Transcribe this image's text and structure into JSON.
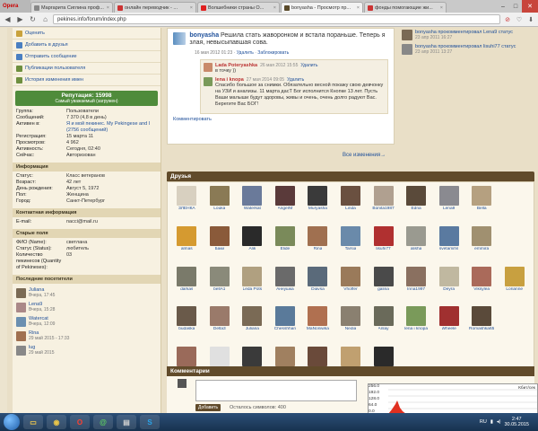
{
  "browser": {
    "menu_label": "Opera",
    "tabs": [
      {
        "label": "Маргарита Сиглина проф...",
        "fav_color": "#888"
      },
      {
        "label": "онлайн переводчик - ...",
        "fav_color": "#c33"
      },
      {
        "label": "Волшебники страны О...",
        "fav_color": "#e02020"
      },
      {
        "label": "bonyasha - Просмотр пр...",
        "fav_color": "#5a4a2a",
        "active": true
      },
      {
        "label": "фонды помогающие жи...",
        "fav_color": "#c33"
      }
    ],
    "url": "pekines.info/forum/index.php"
  },
  "sidebar": {
    "menu": [
      {
        "label": "Оценить",
        "color": "#c9a23c"
      },
      {
        "label": "Добавить в друзья",
        "color": "#4a7fc1"
      },
      {
        "label": "Отправить сообщение",
        "color": "#4a7fc1"
      },
      {
        "label": "Публикации пользователя",
        "color": "#6e8f3f"
      },
      {
        "label": "История изменения имен",
        "color": "#6e8f3f"
      }
    ],
    "reputation_title": "Репутация: 15998",
    "reputation_sub": "Самый уважаемый (загружен)",
    "profile": [
      {
        "k": "Группа:",
        "v": "Пользователи"
      },
      {
        "k": "Сообщений:",
        "v": "7 370 (4,8 в день)"
      },
      {
        "k": "Активен в:",
        "v": "Я и мой пекинес. My Pekingese and I (2756 сообщений)",
        "link": true
      },
      {
        "k": "Регистрация:",
        "v": "15 марта 11"
      },
      {
        "k": "Просмотров:",
        "v": "4 962"
      },
      {
        "k": "Активность:",
        "v": "Сегодня, 02:40"
      },
      {
        "k": "Сейчас:",
        "v": "Авторизован"
      }
    ],
    "info_title": "Информация",
    "info": [
      {
        "k": "Статус:",
        "v": "Класс ветеранов"
      },
      {
        "k": "Возраст:",
        "v": "42 лет"
      },
      {
        "k": "День рождения:",
        "v": "Август 5, 1972"
      },
      {
        "k": "Пол:",
        "v": "Женщина"
      },
      {
        "k": "Город:",
        "v": "Санкт-Петербург"
      }
    ],
    "contacts_title": "Контактная информация",
    "contacts": [
      {
        "k": "E-mail:",
        "v": "nacci@mail.ru"
      }
    ],
    "old_title": "Старые поля",
    "old": [
      {
        "k": "ФИО (Name):",
        "v": "светлана"
      },
      {
        "k": "Статус (Status):",
        "v": "любитель"
      },
      {
        "k": "Количество пекинесов (Quantity of Pekineses):",
        "v": "03"
      }
    ],
    "visitors_title": "Последние посетители",
    "visitors": [
      {
        "n": "Juliana",
        "d": "Вчера, 17:45",
        "c": "#7a6a55"
      },
      {
        "n": "Lena9",
        "d": "Вчера, 15:28",
        "c": "#a88"
      },
      {
        "n": "Watercat",
        "d": "Вчера, 12:09",
        "c": "#6b8fb0"
      },
      {
        "n": "Rina",
        "d": "29 май 2015 - 17:33",
        "c": "#a07050"
      },
      {
        "n": "lug",
        "d": "29 май 2015",
        "c": "#888"
      }
    ]
  },
  "post": {
    "author": "bonyasha",
    "text": "Решила стать жаворонком и встала пораньше. Теперь я злая, невысыпавшая сова.",
    "meta_date": "16 мая 2012 01:23",
    "meta_delete": "Удалить",
    "meta_lock": "Заблокировать",
    "comments": [
      {
        "name": "Lada Poteryashka",
        "date": "26 мая 2012 15:55",
        "delete": "Удалить",
        "text": "в точку ))",
        "c": "#c98a6a"
      },
      {
        "name": "lena i knopa",
        "date": "27 мая 2014 09:05",
        "delete": "Удалить",
        "text": "Спасибо большое за снимки. Обязательно весной покажу свою девчонку на УЗИ и анализы. 11 марта дасТ Бог исполнится Кнопке 13 лет. Пусть Ваши малыши будут здоровы, живы и очень, очень долго радуют Вас. Берегите Вас БОГ!",
        "c": "#7a9a5a"
      }
    ],
    "comment_link": "Комментировать",
    "all_changes": "Все изменения→"
  },
  "right_feed": [
    {
      "t": "bonyasha прокомментировал Lena9 статус",
      "d": "23 апр 2011 16:27",
      "c": "#7a6a55"
    },
    {
      "t": "bonyasha прокомментировал lisuhi77 статус",
      "d": "23 апр 2011 13:27",
      "c": "#888"
    }
  ],
  "friends_title": "Друзья",
  "friends": [
    {
      "n": "ЗЛЁНКА",
      "c": "#d8d0c0"
    },
    {
      "n": "Louka",
      "c": "#8a7a55"
    },
    {
      "n": "Waterkat",
      "c": "#6a7a9a"
    },
    {
      "n": "AngerM",
      "c": "#5a3a3a"
    },
    {
      "n": "Muryasha",
      "c": "#3a3a3a"
    },
    {
      "n": "Linda",
      "c": "#6a5040"
    },
    {
      "n": "Bonita1987",
      "c": "#b0a090"
    },
    {
      "n": "Edna",
      "c": "#5a4a3a"
    },
    {
      "n": "Lena9",
      "c": "#8a8a90"
    },
    {
      "n": "Bella",
      "c": "#b5a080"
    },
    {
      "n": "",
      "c": "#fbf7ec"
    },
    {
      "n": "almas",
      "c": "#d59a30"
    },
    {
      "n": "Баки",
      "c": "#8a5a3a"
    },
    {
      "n": "Alik",
      "c": "#2a2a2a"
    },
    {
      "n": "Elide",
      "c": "#7a8a5a"
    },
    {
      "n": "Rina",
      "c": "#a07050"
    },
    {
      "n": "Tarsia",
      "c": "#6a8aaa"
    },
    {
      "n": "lisuhi77",
      "c": "#b03030"
    },
    {
      "n": "alisha",
      "c": "#9a9a90"
    },
    {
      "n": "svetamihs",
      "c": "#5a7aa0"
    },
    {
      "n": "emmira",
      "c": "#a09070"
    },
    {
      "n": "",
      "c": "#fbf7ec"
    },
    {
      "n": "darkas",
      "c": "#7a7a6a"
    },
    {
      "n": "bellA1",
      "c": "#8a8a7a"
    },
    {
      "n": "Leda Pots",
      "c": "#b0a080"
    },
    {
      "n": "Аннушка",
      "c": "#6a6a6a"
    },
    {
      "n": "Diavsa",
      "c": "#5a6a7a"
    },
    {
      "n": "Vhoffer",
      "c": "#9a7a5a"
    },
    {
      "n": "galina",
      "c": "#4a4a4a"
    },
    {
      "n": "Inna1997",
      "c": "#8a7060"
    },
    {
      "n": "Deyra",
      "c": "#c0b8a0"
    },
    {
      "n": "Viksylea",
      "c": "#aa6a5a"
    },
    {
      "n": "Lorianne",
      "c": "#c8a040"
    },
    {
      "n": "budaska",
      "c": "#6a5a4a"
    },
    {
      "n": "Delta3",
      "c": "#9a7a6a"
    },
    {
      "n": "Juliana",
      "c": "#7a6a55"
    },
    {
      "n": "Chesshhan",
      "c": "#5a7a9a"
    },
    {
      "n": "MaNoniwka",
      "c": "#b07050"
    },
    {
      "n": "Nedia",
      "c": "#8a8070"
    },
    {
      "n": "Anlay",
      "c": "#6a6a5a"
    },
    {
      "n": "lena i knopa",
      "c": "#7a9a5a"
    },
    {
      "n": "Wheele",
      "c": "#a03030"
    },
    {
      "n": "Romashka65",
      "c": "#5a4a3a"
    },
    {
      "n": "",
      "c": "#fbf7ec"
    },
    {
      "n": "Zenas",
      "c": "#9a6a5a"
    },
    {
      "n": "ray777",
      "c": "#e0e0e0"
    },
    {
      "n": "double",
      "c": "#3a3a3a"
    },
    {
      "n": "Bandinaiha",
      "c": "#a08060"
    },
    {
      "n": "Zizarh",
      "c": "#6a4a3a"
    },
    {
      "n": "Татьяна НН",
      "c": "#c0a070"
    },
    {
      "n": "Neliena",
      "c": "#2a2a2a"
    },
    {
      "n": "",
      "c": "#fbf7ec"
    },
    {
      "n": "",
      "c": "#fbf7ec"
    },
    {
      "n": "",
      "c": "#fbf7ec"
    },
    {
      "n": "",
      "c": "#fbf7ec"
    }
  ],
  "comments_title": "Комментарии",
  "comment_form": {
    "button": "Добавить",
    "left": "Осталось символов: 400"
  },
  "widget": {
    "ticks": [
      "256.0",
      "192.0",
      "128.0",
      "64.0",
      "0.0"
    ],
    "legend": "Кбит/сек"
  },
  "taskbar": {
    "lang": "RU",
    "time": "2:47",
    "date": "30.05.2015"
  }
}
